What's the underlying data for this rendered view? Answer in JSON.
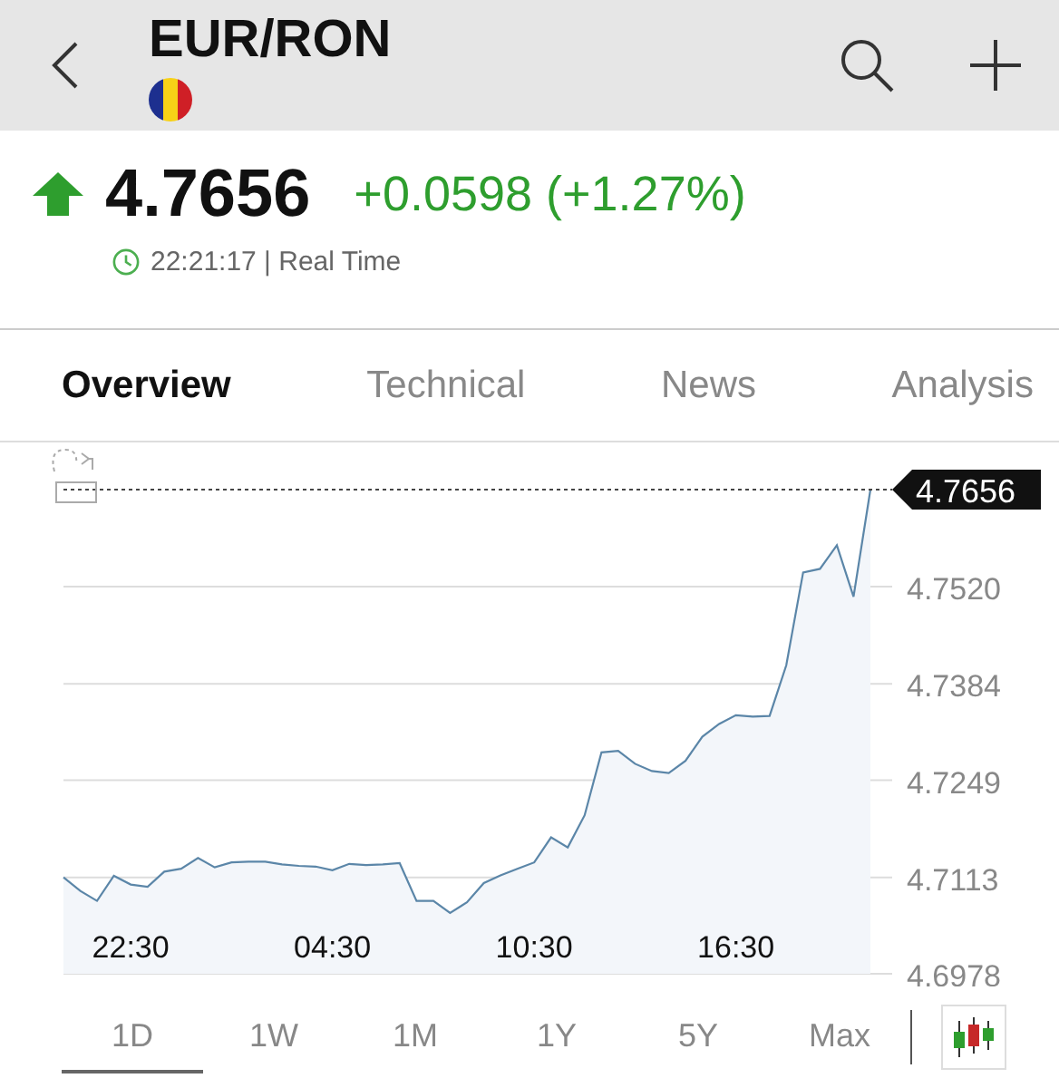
{
  "header": {
    "title": "EUR/RON"
  },
  "quote": {
    "price": "4.7656",
    "change": "+0.0598 (+1.27%)",
    "rising": true,
    "time": "22:21:17 | Real Time"
  },
  "tabs": [
    {
      "label": "Overview",
      "selected": true
    },
    {
      "label": "Technical",
      "selected": false
    },
    {
      "label": "News",
      "selected": false
    },
    {
      "label": "Analysis",
      "selected": false
    }
  ],
  "chart": {
    "last_price": "4.7656",
    "chart_data": {
      "type": "area",
      "grid": true,
      "ylim": [
        4.6978,
        4.7656
      ],
      "categories": [
        null,
        null,
        null,
        null,
        "22:30",
        null,
        null,
        null,
        null,
        null,
        null,
        null,
        null,
        null,
        null,
        null,
        "04:30",
        null,
        null,
        null,
        null,
        null,
        null,
        null,
        null,
        null,
        null,
        null,
        "10:30",
        null,
        null,
        null,
        null,
        null,
        null,
        null,
        null,
        null,
        null,
        null,
        "16:30",
        null,
        null,
        null,
        null,
        null,
        null,
        null,
        null
      ],
      "yticks": [
        {
          "value": 4.6978,
          "label": "4.6978"
        },
        {
          "value": 4.7113,
          "label": "4.7113"
        },
        {
          "value": 4.7249,
          "label": "4.7249"
        },
        {
          "value": 4.7384,
          "label": "4.7384"
        },
        {
          "value": 4.752,
          "label": "4.7520"
        }
      ],
      "series": [
        {
          "color": "#5b86a8",
          "values": [
            4.7113,
            4.7094,
            4.708,
            4.7115,
            4.7103,
            4.71,
            4.7121,
            4.7125,
            4.714,
            4.7127,
            4.7134,
            4.7135,
            4.7135,
            4.7131,
            4.7129,
            4.7128,
            4.7123,
            4.7132,
            4.713,
            4.7131,
            4.7133,
            4.708,
            4.708,
            4.7063,
            4.7078,
            4.7105,
            4.7116,
            4.7125,
            4.7134,
            4.7169,
            4.7155,
            4.72,
            4.7288,
            4.729,
            4.7272,
            4.7262,
            4.7259,
            4.7276,
            4.731,
            4.7328,
            4.734,
            4.7338,
            4.7339,
            4.741,
            4.754,
            4.7545,
            4.7578,
            4.7506,
            4.7656
          ]
        }
      ]
    }
  },
  "ranges": [
    {
      "label": "1D",
      "selected": true
    },
    {
      "label": "1W",
      "selected": false
    },
    {
      "label": "1M",
      "selected": false
    },
    {
      "label": "1Y",
      "selected": false
    },
    {
      "label": "5Y",
      "selected": false
    },
    {
      "label": "Max",
      "selected": false
    }
  ]
}
